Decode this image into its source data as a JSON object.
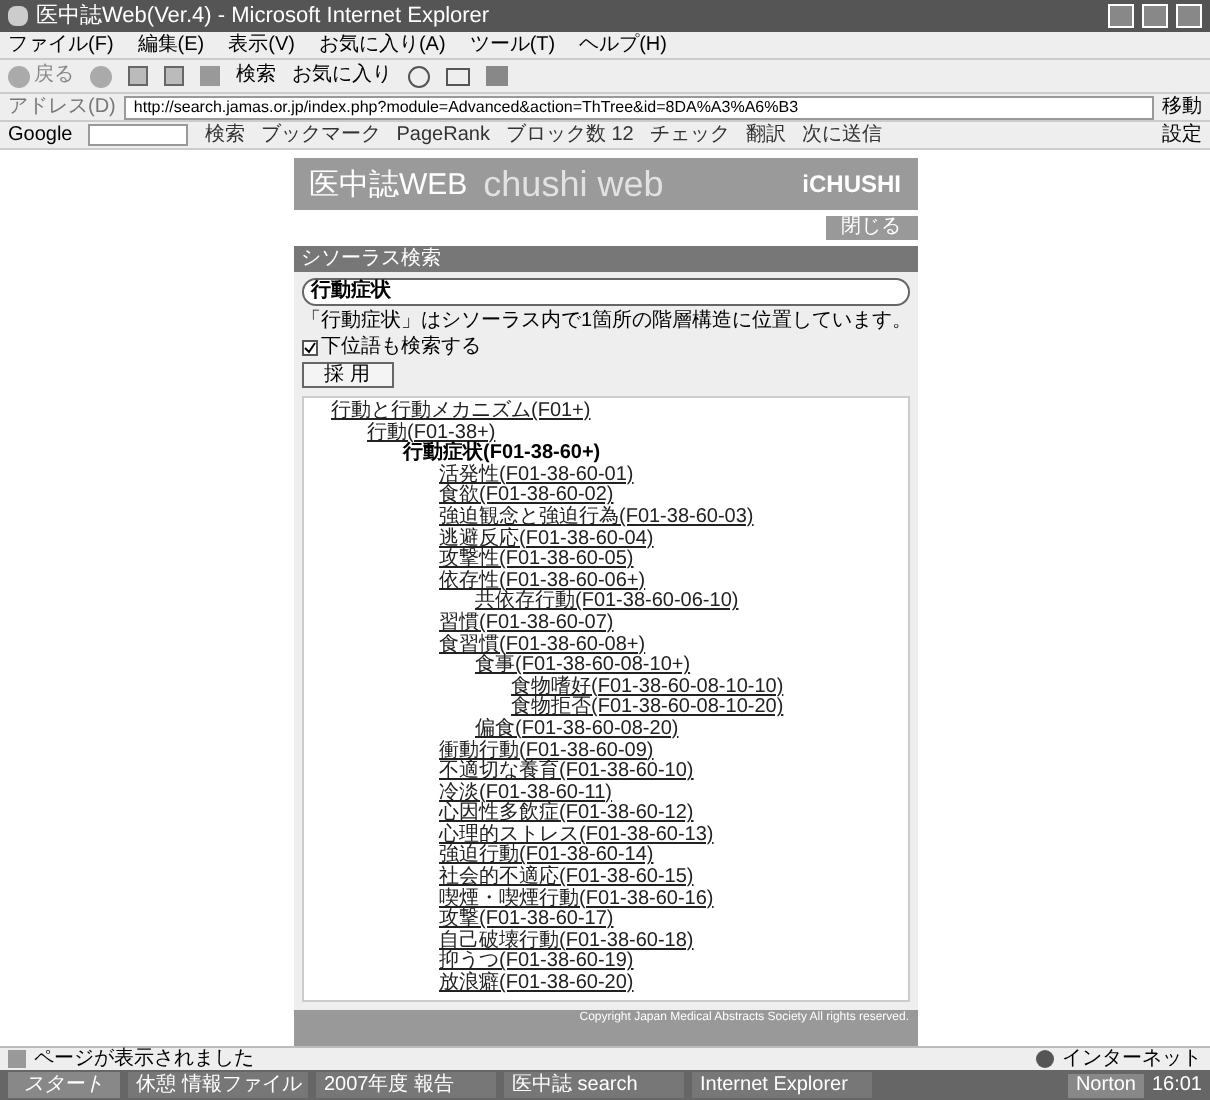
{
  "window": {
    "title": "医中誌Web(Ver.4) - Microsoft Internet Explorer"
  },
  "menu": [
    "ファイル(F)",
    "編集(E)",
    "表示(V)",
    "お気に入り(A)",
    "ツール(T)",
    "ヘルプ(H)"
  ],
  "toolbar": {
    "back": "戻る",
    "search": "検索",
    "favorites": "お気に入り"
  },
  "address": {
    "label": "アドレス(D)",
    "url": "http://search.jamas.or.jp/index.php?module=Advanced&action=ThTree&id=8DA%A3%A6%B3",
    "go": "移動"
  },
  "google_bar": {
    "label": "Google",
    "items": [
      "検索",
      "ブックマーク",
      "PageRank",
      "ブロック数 12",
      "チェック",
      "翻訳",
      "次に送信"
    ],
    "settings": "設定"
  },
  "page": {
    "logo": "医中誌WEB",
    "logo_bg": "chushi web",
    "brand": "iCHUSHI",
    "close": "閉じる",
    "section": "シソーラス検索",
    "term": "行動症状",
    "message": "「行動症状」はシソーラス内で1箇所の階層構造に位置しています。",
    "include_lower": {
      "label": "下位語も検索する",
      "checked": true
    },
    "adopt": "採 用",
    "tree": [
      {
        "label": "行動と行動メカニズム(F01+)",
        "current": false,
        "children": [
          {
            "label": "行動(F01-38+)",
            "current": false,
            "children": [
              {
                "label": "行動症状(F01-38-60+)",
                "current": true,
                "children": [
                  {
                    "label": "活発性(F01-38-60-01)",
                    "current": false
                  },
                  {
                    "label": "食欲(F01-38-60-02)",
                    "current": false
                  },
                  {
                    "label": "強迫観念と強迫行為(F01-38-60-03)",
                    "current": false
                  },
                  {
                    "label": "逃避反応(F01-38-60-04)",
                    "current": false
                  },
                  {
                    "label": "攻撃性(F01-38-60-05)",
                    "current": false
                  },
                  {
                    "label": "依存性(F01-38-60-06+)",
                    "current": false,
                    "children": [
                      {
                        "label": "共依存行動(F01-38-60-06-10)",
                        "current": false
                      }
                    ]
                  },
                  {
                    "label": "習慣(F01-38-60-07)",
                    "current": false
                  },
                  {
                    "label": "食習慣(F01-38-60-08+)",
                    "current": false,
                    "children": [
                      {
                        "label": "食事(F01-38-60-08-10+)",
                        "current": false,
                        "children": [
                          {
                            "label": "食物嗜好(F01-38-60-08-10-10)",
                            "current": false
                          },
                          {
                            "label": "食物拒否(F01-38-60-08-10-20)",
                            "current": false
                          }
                        ]
                      },
                      {
                        "label": "偏食(F01-38-60-08-20)",
                        "current": false
                      }
                    ]
                  },
                  {
                    "label": "衝動行動(F01-38-60-09)",
                    "current": false
                  },
                  {
                    "label": "不適切な養育(F01-38-60-10)",
                    "current": false
                  },
                  {
                    "label": "冷淡(F01-38-60-11)",
                    "current": false
                  },
                  {
                    "label": "心因性多飲症(F01-38-60-12)",
                    "current": false
                  },
                  {
                    "label": "心理的ストレス(F01-38-60-13)",
                    "current": false
                  },
                  {
                    "label": "強迫行動(F01-38-60-14)",
                    "current": false
                  },
                  {
                    "label": "社会的不適応(F01-38-60-15)",
                    "current": false
                  },
                  {
                    "label": "喫煙・喫煙行動(F01-38-60-16)",
                    "current": false
                  },
                  {
                    "label": "攻撃(F01-38-60-17)",
                    "current": false
                  },
                  {
                    "label": "自己破壊行動(F01-38-60-18)",
                    "current": false
                  },
                  {
                    "label": "抑うつ(F01-38-60-19)",
                    "current": false
                  },
                  {
                    "label": "放浪癖(F01-38-60-20)",
                    "current": false
                  }
                ]
              }
            ]
          }
        ]
      }
    ],
    "copyright": "Copyright Japan Medical Abstracts Society All rights reserved."
  },
  "status_bar": {
    "text": "ページが表示されました",
    "zone": "インターネット"
  },
  "taskbar": {
    "start": "スタート",
    "tasks": [
      "休憩 情報ファイル",
      "2007年度 報告",
      "医中誌 search",
      "Internet Explorer"
    ],
    "tray": "Norton",
    "clock": "16:01"
  }
}
